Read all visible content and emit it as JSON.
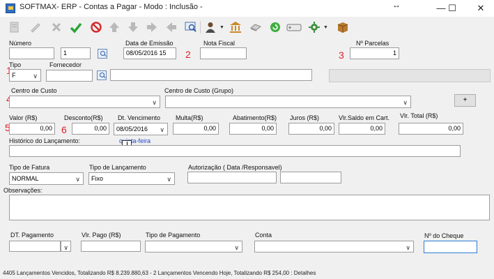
{
  "window": {
    "title": "SOFTMAX- ERP - Contas a Pagar  - Modo : Inclusão -",
    "minimize": "—",
    "maximize": "☐",
    "close": "✕",
    "resize_glyph": "↔"
  },
  "toolbar": {
    "icons": [
      "new-record-icon",
      "edit-icon",
      "delete-icon",
      "confirm-check-icon",
      "cancel-icon",
      "first-record-icon",
      "previous-record-icon",
      "next-record-icon",
      "last-record-icon",
      "search-icon",
      "user-icon",
      "bank-icon",
      "printer-icon",
      "refresh-icon",
      "tag-icon",
      "settings-icon",
      "package-icon"
    ]
  },
  "annotations": [
    "1",
    "2",
    "3",
    "4",
    "5",
    "6",
    "7"
  ],
  "header": {
    "numero_label": "Número",
    "numero_value": "",
    "serie_value": "1",
    "data_emissao_label": "Data de Emissão",
    "data_emissao_value": "08/05/2016 15",
    "nota_fiscal_label": "Nota Fiscal",
    "nota_fiscal_value": "",
    "parcelas_label": "Nº Parcelas",
    "parcelas_value": "1",
    "tipo_label": "Tipo",
    "tipo_value": "F",
    "fornecedor_label": "Fornecedor",
    "fornecedor_value": "",
    "fornecedor_name_value": ""
  },
  "centro": {
    "centro_custo_label": "Centro de Custo",
    "centro_custo_value": "",
    "centro_grupo_label": "Centro de Custo (Grupo)",
    "centro_grupo_value": "",
    "add_label": "+"
  },
  "valores": {
    "valor_label": "Valor (R$)",
    "valor_value": "0,00",
    "desconto_label": "Desconto(R$)",
    "desconto_value": "0,00",
    "vencimento_label": "Dt. Vencimento",
    "vencimento_value": "08/05/2016",
    "vencimento_weekday": "quinta-feira",
    "multa_label": "Multa(R$)",
    "multa_value": "0,00",
    "abatimento_label": "Abatimento(R$)",
    "abatimento_value": "0,00",
    "juros_label": "Juros (R$)",
    "juros_value": "0,00",
    "saldo_label": "Vlr.Saldo em Cart.",
    "saldo_value": "0,00",
    "total_label": "Vlr. Total (R$)",
    "total_value": "0,00"
  },
  "historico": {
    "label": "Histórico do Lançamento:",
    "value": ""
  },
  "fatura": {
    "tipo_fatura_label": "Tipo de Fatura",
    "tipo_fatura_value": "NORMAL",
    "tipo_lancamento_label": "Tipo de Lançamento",
    "tipo_lancamento_value": "Fixo",
    "autorizacao_label": "Autorização ( Data /Responsavel)",
    "autorizacao_data": "",
    "autorizacao_responsavel": ""
  },
  "observacoes": {
    "label": "Observações:",
    "value": ""
  },
  "pagamento": {
    "dt_pagamento_label": "DT. Pagamento",
    "dt_pagamento_value": "",
    "vlr_pago_label": "Vlr. Pago (R$)",
    "vlr_pago_value": "",
    "tipo_pagamento_label": "Tipo de Pagamento",
    "tipo_pagamento_value": "",
    "conta_label": "Conta",
    "conta_value": "",
    "cheque_label": "Nº do Cheque",
    "cheque_value": ""
  },
  "status_bar": {
    "text": "4405 Lançamentos Vencidos, Totalizando R$ 8.239.880,63 - 2 Lançamentos Vencendo Hoje, Totalizando R$ 254,00    : Detalhes"
  },
  "colors": {
    "annotation": "#e0202a",
    "link": "#2348c9",
    "focus_border": "#2e7bd6"
  }
}
